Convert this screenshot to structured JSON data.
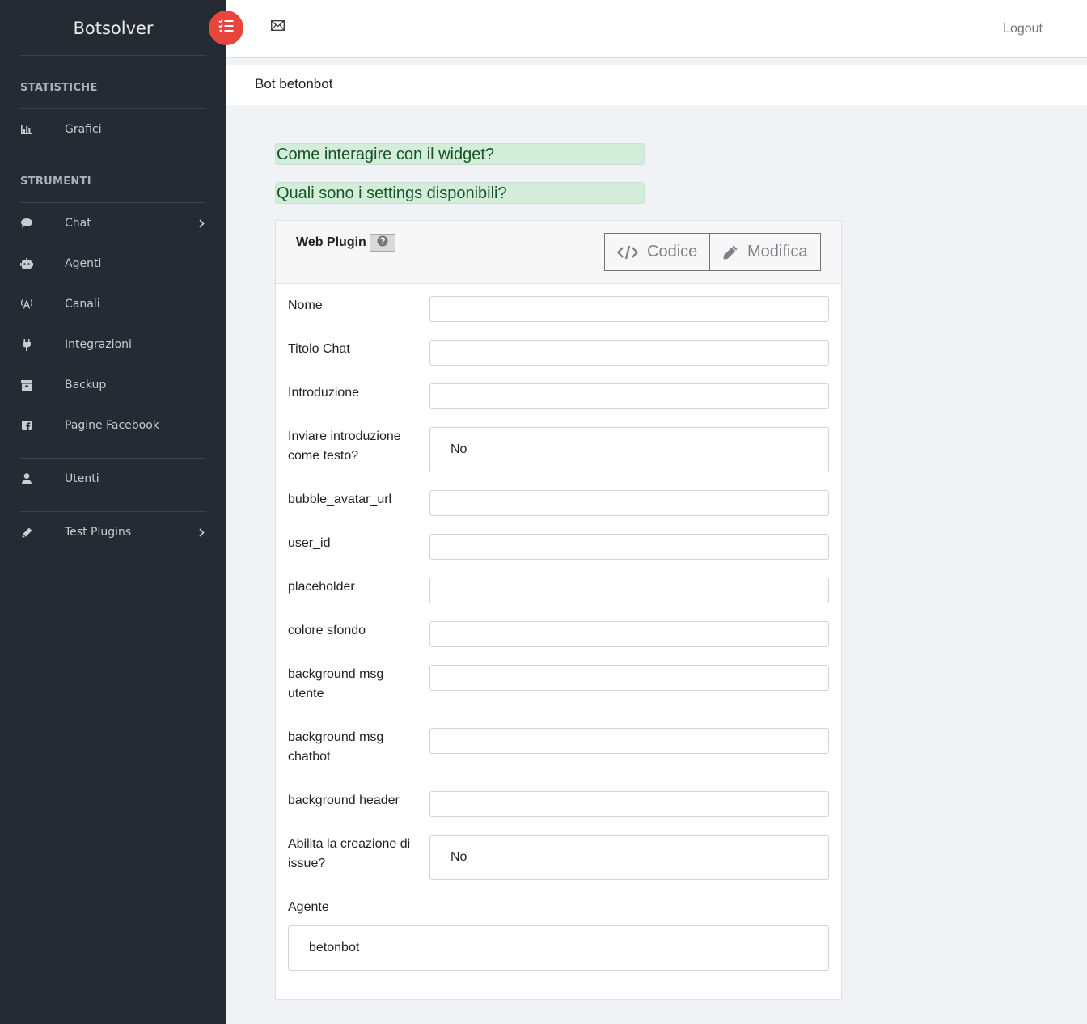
{
  "brand": "Botsolver",
  "sidebar": {
    "sections": [
      {
        "title": "STATISTICHE"
      },
      {
        "title": "STRUMENTI"
      }
    ],
    "items": [
      {
        "label": "Grafici",
        "icon": "bar-chart-icon"
      },
      {
        "label": "Chat",
        "icon": "chat-bubble-icon"
      },
      {
        "label": "Agenti",
        "icon": "robot-icon"
      },
      {
        "label": "Canali",
        "icon": "broadcast-icon"
      },
      {
        "label": "Integrazioni",
        "icon": "plug-icon"
      },
      {
        "label": "Backup",
        "icon": "archive-icon"
      },
      {
        "label": "Pagine Facebook",
        "icon": "facebook-icon"
      },
      {
        "label": "Utenti",
        "icon": "user-icon"
      },
      {
        "label": "Test Plugins",
        "icon": "pencil-icon"
      }
    ]
  },
  "topbar": {
    "logout": "Logout"
  },
  "page": {
    "title": "Bot betonbot"
  },
  "help_links": [
    "Come interagire con il widget?",
    "Quali sono i settings disponibili?"
  ],
  "card": {
    "title": "Web Plugin",
    "code_button": "Codice",
    "edit_button": "Modifica",
    "fields": [
      {
        "label": "Nome",
        "value": ""
      },
      {
        "label": "Titolo Chat",
        "value": ""
      },
      {
        "label": "Introduzione",
        "value": ""
      },
      {
        "label": "Inviare introduzione come testo?",
        "value": "No"
      },
      {
        "label": "bubble_avatar_url",
        "value": ""
      },
      {
        "label": "user_id",
        "value": ""
      },
      {
        "label": "placeholder",
        "value": ""
      },
      {
        "label": "colore sfondo",
        "value": ""
      },
      {
        "label": "background msg utente",
        "value": ""
      },
      {
        "label": "background msg chatbot",
        "value": ""
      },
      {
        "label": "background header",
        "value": ""
      },
      {
        "label": "Abilita la creazione di issue?",
        "value": "No"
      }
    ],
    "agent_label": "Agente",
    "agent_value": "betonbot"
  },
  "colors": {
    "sidebar_bg": "#252a33",
    "accent": "#e8453c",
    "help_bg": "#d4edda",
    "help_text": "#155724"
  }
}
